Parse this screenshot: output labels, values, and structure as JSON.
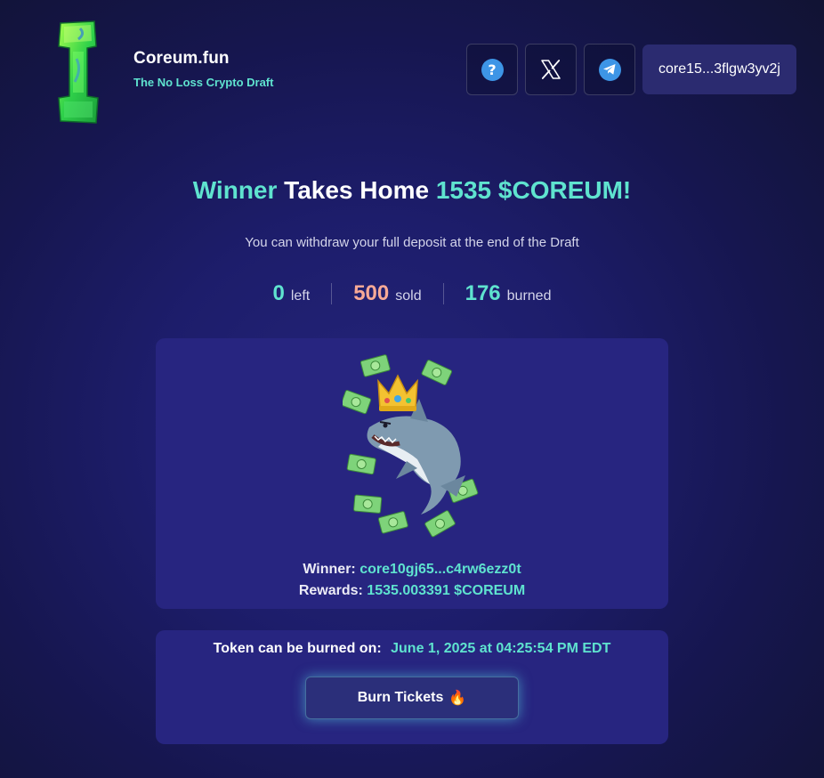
{
  "header": {
    "brand_title": "Coreum.fun",
    "brand_tagline": "The No Loss Crypto Draft",
    "help_symbol": "?",
    "wallet_label": "core15...3flgw3yv2j",
    "icons": [
      "help-circle-icon",
      "x-logo-icon",
      "telegram-icon"
    ]
  },
  "hero": {
    "headline_part1": "Winner",
    "headline_part2": " Takes Home ",
    "headline_part3": "1535 $COREUM!",
    "subline": "You can withdraw your full deposit at the end of the Draft"
  },
  "stats": {
    "left_value": "0",
    "left_label": "left",
    "sold_value": "500",
    "sold_label": "sold",
    "burned_value": "176",
    "burned_label": "burned"
  },
  "winner": {
    "winner_label": "Winner:",
    "winner_address": "core10gj65...c4rw6ezz0t",
    "rewards_label": "Rewards:",
    "rewards_value": "1535.003391 $COREUM"
  },
  "burn": {
    "label": "Token can be burned on:",
    "date": "June 1, 2025 at 04:25:54 PM EDT",
    "button_label": "Burn Tickets",
    "button_emoji": "🔥"
  },
  "colors": {
    "accent": "#5fe3cf",
    "sold": "#f7a996",
    "card": "#272580",
    "wallet_bg": "#2b2b70"
  }
}
